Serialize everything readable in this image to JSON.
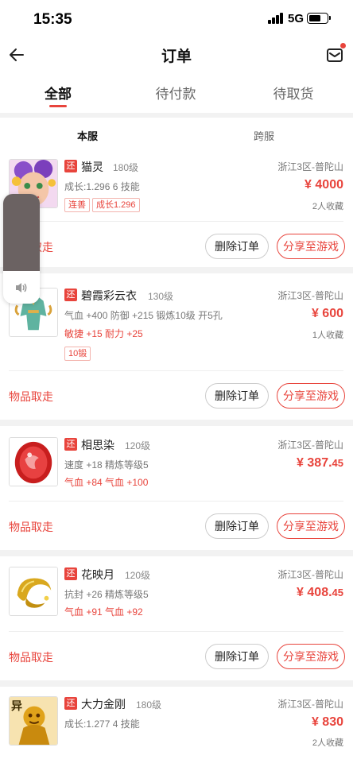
{
  "status": {
    "time": "15:35",
    "network": "5G"
  },
  "header": {
    "title": "订单",
    "back_icon": "arrow-left-icon",
    "mail_icon": "mail-icon"
  },
  "tabs": [
    {
      "label": "全部"
    },
    {
      "label": "待付款"
    },
    {
      "label": "待取货"
    }
  ],
  "subtabs": [
    {
      "label": "本服"
    },
    {
      "label": "跨服"
    }
  ],
  "colors": {
    "accent": "#e8443c",
    "background": "#f2f2f2"
  },
  "orders": [
    {
      "tag": "还",
      "name": "猫灵",
      "level": "180级",
      "server": "浙江3区-普陀山",
      "line1": "成长:1.296 6 技能",
      "line2": "",
      "chips": [
        "连善",
        "成长1.296"
      ],
      "price_symbol": "¥",
      "price": "4000",
      "favorites": "2人收藏",
      "pickup": "物品取走",
      "delete": "删除订单",
      "share": "分享至游戏"
    },
    {
      "tag": "还",
      "name": "碧霞彩云衣",
      "level": "130级",
      "server": "浙江3区-普陀山",
      "line1": "气血 +400 防御 +215 锻炼10级 开5孔",
      "line2": "敏捷 +15 耐力 +25",
      "chips": [
        "10锻"
      ],
      "price_symbol": "¥",
      "price": "600",
      "favorites": "1人收藏",
      "pickup": "物品取走",
      "delete": "删除订单",
      "share": "分享至游戏"
    },
    {
      "tag": "还",
      "name": "相思染",
      "level": "120级",
      "server": "浙江3区-普陀山",
      "line1": "速度 +18 精炼等级5",
      "line2": "气血 +84 气血 +100",
      "chips": [],
      "price_symbol": "¥",
      "price": "387.45",
      "favorites": "",
      "pickup": "物品取走",
      "delete": "删除订单",
      "share": "分享至游戏"
    },
    {
      "tag": "还",
      "name": "花映月",
      "level": "120级",
      "server": "浙江3区-普陀山",
      "line1": "抗封 +26 精炼等级5",
      "line2": "气血 +91 气血 +92",
      "chips": [],
      "price_symbol": "¥",
      "price": "408.45",
      "favorites": "",
      "pickup": "物品取走",
      "delete": "删除订单",
      "share": "分享至游戏"
    },
    {
      "tag": "还",
      "name": "大力金刚",
      "level": "180级",
      "server": "浙江3区-普陀山",
      "line1": "成长:1.277 4 技能",
      "line2": "",
      "chips": [],
      "price_symbol": "¥",
      "price": "830",
      "favorites": "2人收藏",
      "thumb_badge": "异",
      "pickup": "",
      "delete": "",
      "share": ""
    }
  ],
  "volume_overlay": {
    "level": 0.7,
    "icon": "speaker-icon"
  }
}
